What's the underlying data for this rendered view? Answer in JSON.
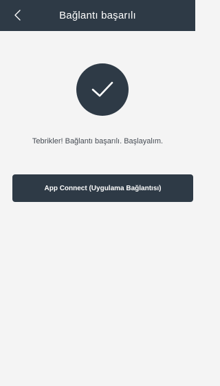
{
  "header": {
    "title": "Bağlantı başarılı",
    "back_icon": "chevron-left-icon"
  },
  "status": {
    "icon": "checkmark-icon",
    "message": "Tebrikler! Bağlantı başarılı. Başlayalım."
  },
  "actions": {
    "app_connect_label": "App Connect (Uygulama Bağlantısı)"
  },
  "colors": {
    "primary": "#2e3a46",
    "background": "#f4f4f4",
    "text": "#444a52"
  }
}
